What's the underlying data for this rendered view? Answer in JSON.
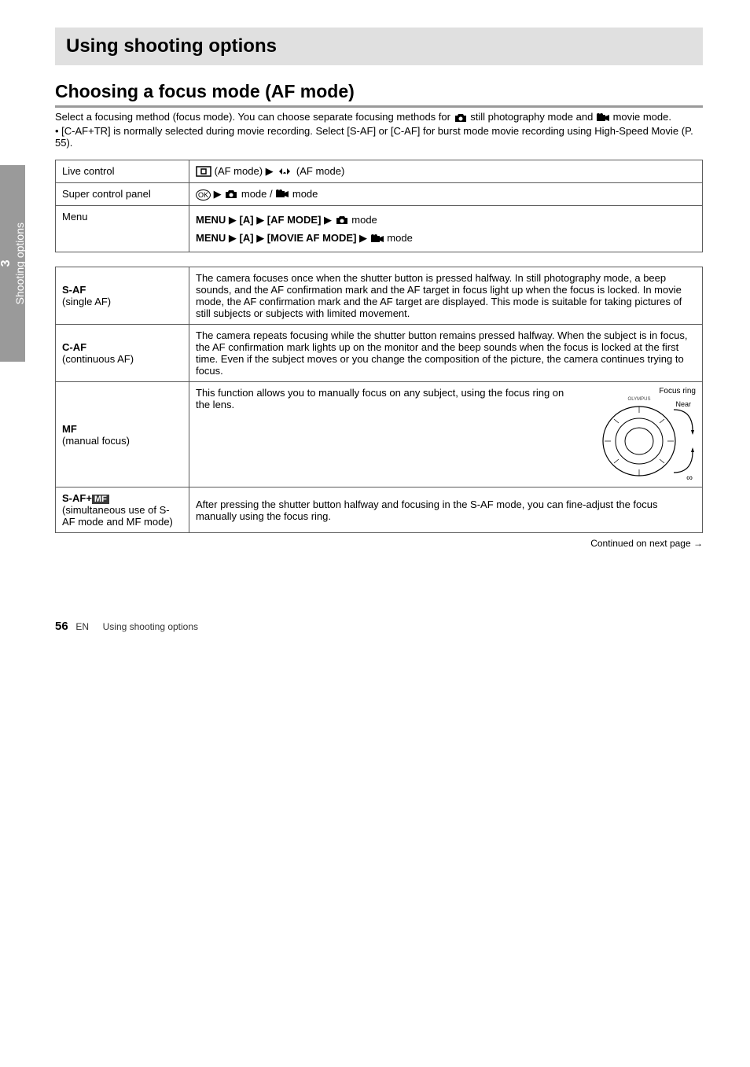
{
  "sidebar": {
    "number": "3",
    "label": "Shooting options"
  },
  "header": "Using shooting options",
  "section": {
    "title": "Choosing a focus mode (AF mode)",
    "subtitle_prefix": "Select a focusing method (focus mode). You can choose separate focusing methods for ",
    "subtitle_still": " still photography mode and ",
    "subtitle_movie1": " movie mode.",
    "subtitle_movie2": "• [C-AF+TR] is normally selected during movie recording. Select [S-AF] or [C-AF] for  burst mode movie recording using High-Speed Movie (P. 55)."
  },
  "nav_table": {
    "rows": [
      {
        "label": "Live control",
        "icon_note": "(AF mode)",
        "arrow_note": " ",
        "tail": "(AF mode)"
      },
      {
        "label": "Super control panel",
        "icon_note": "",
        "arrow_note": "",
        "tail": " mode /  mode"
      },
      {
        "label": "Menu",
        "line1_parts": [
          "MENU",
          "[A]",
          "[AF MODE]",
          " mode"
        ],
        "line2_parts": [
          "MENU",
          "[A]",
          "[MOVIE AF MODE]",
          " mode"
        ]
      }
    ]
  },
  "af_table": [
    {
      "label": "S-AF",
      "sub": "(single AF)",
      "body": "The camera focuses once when the shutter button is pressed halfway. In still photography mode, a beep sounds, and the AF confirmation mark and the AF target in focus light up when the focus is locked. In movie mode, the AF confirmation mark and the AF target are displayed. This mode is suitable for taking pictures of still subjects or subjects with limited movement.",
      "has_figure": false
    },
    {
      "label": "C-AF",
      "sub": "(continuous AF)",
      "body": "The camera repeats focusing while the shutter button remains pressed halfway. When the subject is in focus, the AF confirmation mark lights up on the monitor and the beep sounds when the focus is locked at the first time. Even if the subject moves or you change the composition of the picture, the camera continues trying to focus.",
      "has_figure": false
    },
    {
      "label": "MF",
      "sub": "(manual focus)",
      "body": "This function allows you to manually focus on any subject, using the focus ring on the lens.",
      "has_figure": true,
      "figure_labels": {
        "ring": "Focus ring",
        "near": "Near",
        "far": "∞"
      }
    },
    {
      "label": "S-AF+MF",
      "sub": "(simultaneous use of S-AF mode and MF mode)",
      "body": "After pressing the shutter button halfway and focusing in the S-AF mode, you can fine-adjust the focus manually using the focus ring.",
      "has_figure": false,
      "badge": "MF"
    }
  ],
  "continued": "Continued on next page →",
  "footer": {
    "page": "56",
    "text": "EN",
    "section": "Using shooting options"
  },
  "icons": {
    "af_target": "AF-target-icon",
    "dpad": "dpad-icon",
    "ok": "OK",
    "arrow": "▶",
    "camera": "camera-icon",
    "movie": "movie-icon"
  }
}
